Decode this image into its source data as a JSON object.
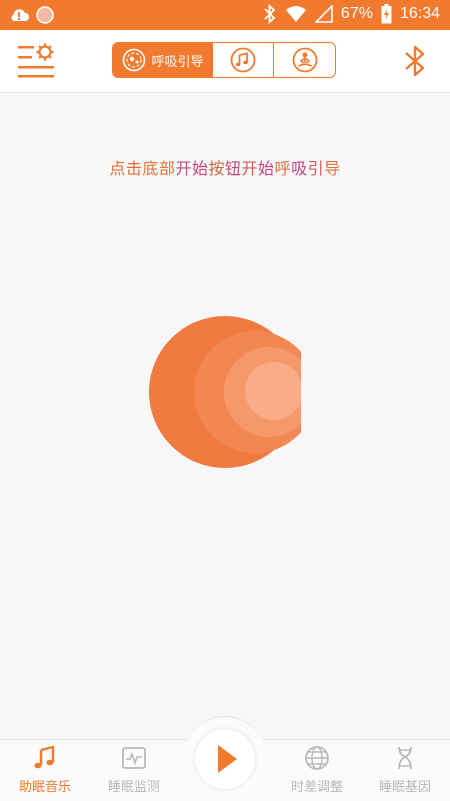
{
  "status_bar": {
    "battery": "67%",
    "time": "16:34",
    "icons": [
      "alert-icon",
      "notification-dot-icon",
      "bluetooth-icon",
      "wifi-icon",
      "signal-icon",
      "battery-charging-icon"
    ]
  },
  "header": {
    "menu_icon": "menu-settings-icon",
    "bluetooth_icon": "bluetooth-icon",
    "tabs": [
      {
        "label": "呼吸引导",
        "icon": "breath-icon",
        "active": true
      },
      {
        "label": "",
        "icon": "music-note-icon",
        "active": false
      },
      {
        "label": "",
        "icon": "meditation-icon",
        "active": false
      }
    ]
  },
  "main": {
    "hint_chars": [
      {
        "ch": "点",
        "color": "#e8702e"
      },
      {
        "ch": "击",
        "color": "#e86a34"
      },
      {
        "ch": "底",
        "color": "#e0773a"
      },
      {
        "ch": "部",
        "color": "#e0773a"
      },
      {
        "ch": "开",
        "color": "#c04a7a"
      },
      {
        "ch": "始",
        "color": "#c8447a"
      },
      {
        "ch": "按",
        "color": "#cc6a3c"
      },
      {
        "ch": "钮",
        "color": "#c04a7a"
      },
      {
        "ch": "开",
        "color": "#d85a5c"
      },
      {
        "ch": "始",
        "color": "#c8447a"
      },
      {
        "ch": "呼",
        "color": "#e0703e"
      },
      {
        "ch": "吸",
        "color": "#c8447a"
      },
      {
        "ch": "引",
        "color": "#d85a5c"
      },
      {
        "ch": "导",
        "color": "#e0703e"
      }
    ]
  },
  "bottom_nav": {
    "items": [
      {
        "label": "助眠音乐",
        "icon": "music-note-icon",
        "active": true
      },
      {
        "label": "睡眠监测",
        "icon": "monitor-wave-icon",
        "active": false
      },
      {
        "label": "时差调整",
        "icon": "globe-icon",
        "active": false
      },
      {
        "label": "睡眠基因",
        "icon": "dna-icon",
        "active": false
      }
    ],
    "play_icon": "play-icon"
  },
  "colors": {
    "accent": "#f27a2e",
    "inactive": "#b9b9b9"
  }
}
